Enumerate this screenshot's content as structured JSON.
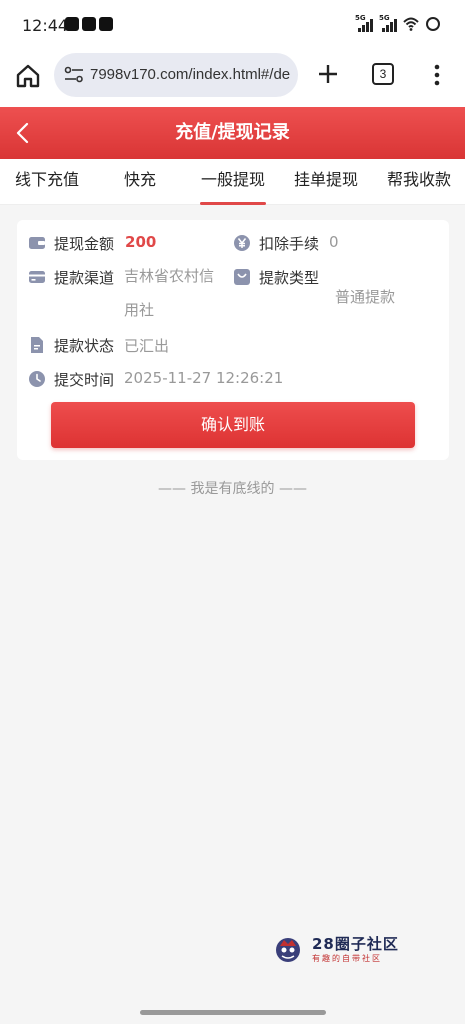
{
  "status": {
    "time": "12:44",
    "signal1": "5G",
    "signal2": "5G"
  },
  "browser": {
    "url": "7998v170.com/index.html#/de",
    "tab_count": "3"
  },
  "header": {
    "title": "充值/提现记录"
  },
  "tabs": [
    {
      "label": "线下充值",
      "active": false
    },
    {
      "label": "快充",
      "active": false
    },
    {
      "label": "一般提现",
      "active": true
    },
    {
      "label": "挂单提现",
      "active": false
    },
    {
      "label": "帮我收款",
      "active": false
    }
  ],
  "record": {
    "amount_label": "提现金额",
    "amount_value": "200",
    "fee_label": "扣除手续",
    "fee_value": "0",
    "channel_label": "提款渠道",
    "channel_value_line1": "吉林省农村信",
    "channel_value_line2": "用社",
    "type_label": "提款类型",
    "type_value": "普通提款",
    "status_label": "提款状态",
    "status_value": "已汇出",
    "time_label": "提交时间",
    "time_value": "2025-11-27 12:26:21",
    "confirm_button": "确认到账"
  },
  "footer": {
    "bottom_text": "—— 我是有底线的 ——"
  },
  "watermark": {
    "title": "28圈子社区",
    "subtitle": "有趣的自带社区"
  },
  "colors": {
    "accent": "#e04848",
    "header_red": "#e44444",
    "icon_slate": "#8c93ad"
  }
}
